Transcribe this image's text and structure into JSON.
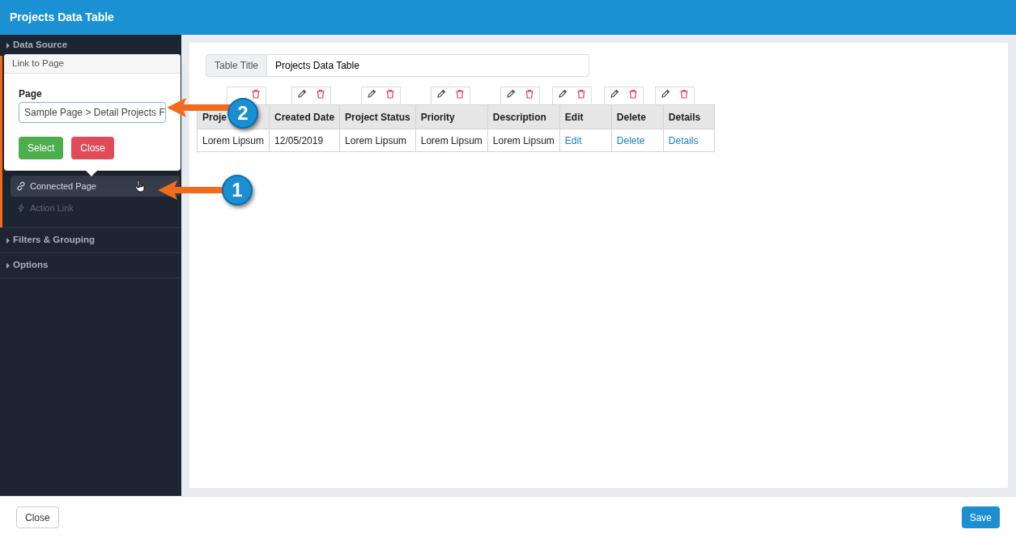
{
  "header": {
    "title": "Projects Data Table"
  },
  "sidebar": {
    "sections": [
      {
        "label": "Data Source",
        "items": [
          {
            "label": "Connected Page",
            "selected": true,
            "disabled": false,
            "kind": "link"
          },
          {
            "label": "Action Link",
            "selected": false,
            "disabled": true,
            "kind": "action"
          }
        ]
      },
      {
        "label": "Filters & Grouping"
      },
      {
        "label": "Options"
      }
    ]
  },
  "popover": {
    "title": "Link to Page",
    "field_label": "Page",
    "select_value": "Sample Page > Detail Projects F",
    "buttons": [
      {
        "label": "Select",
        "kind": "success"
      },
      {
        "label": "Close",
        "kind": "danger"
      }
    ]
  },
  "title_field": {
    "label": "Table Title",
    "value": "Projects Data Table"
  },
  "table": {
    "columns": [
      "Proje",
      "Created Date",
      "Project Status",
      "Priority",
      "Description",
      "Edit",
      "Delete",
      "Details"
    ],
    "rows": [
      [
        {
          "text": "Lorem Lipsum",
          "kind": "text"
        },
        {
          "text": "12/05/2019",
          "kind": "text"
        },
        {
          "text": "Lorem Lipsum",
          "kind": "text"
        },
        {
          "text": "Lorem Lipsum",
          "kind": "text"
        },
        {
          "text": "Lorem Lipsum",
          "kind": "text"
        },
        {
          "text": "Edit",
          "kind": "link"
        },
        {
          "text": "Delete",
          "kind": "link"
        },
        {
          "text": "Details",
          "kind": "link"
        }
      ]
    ]
  },
  "callouts": [
    "2",
    "1"
  ],
  "footer": {
    "buttons": [
      {
        "label": "Close",
        "kind": "default"
      },
      {
        "label": "Save",
        "kind": "primary"
      }
    ]
  }
}
